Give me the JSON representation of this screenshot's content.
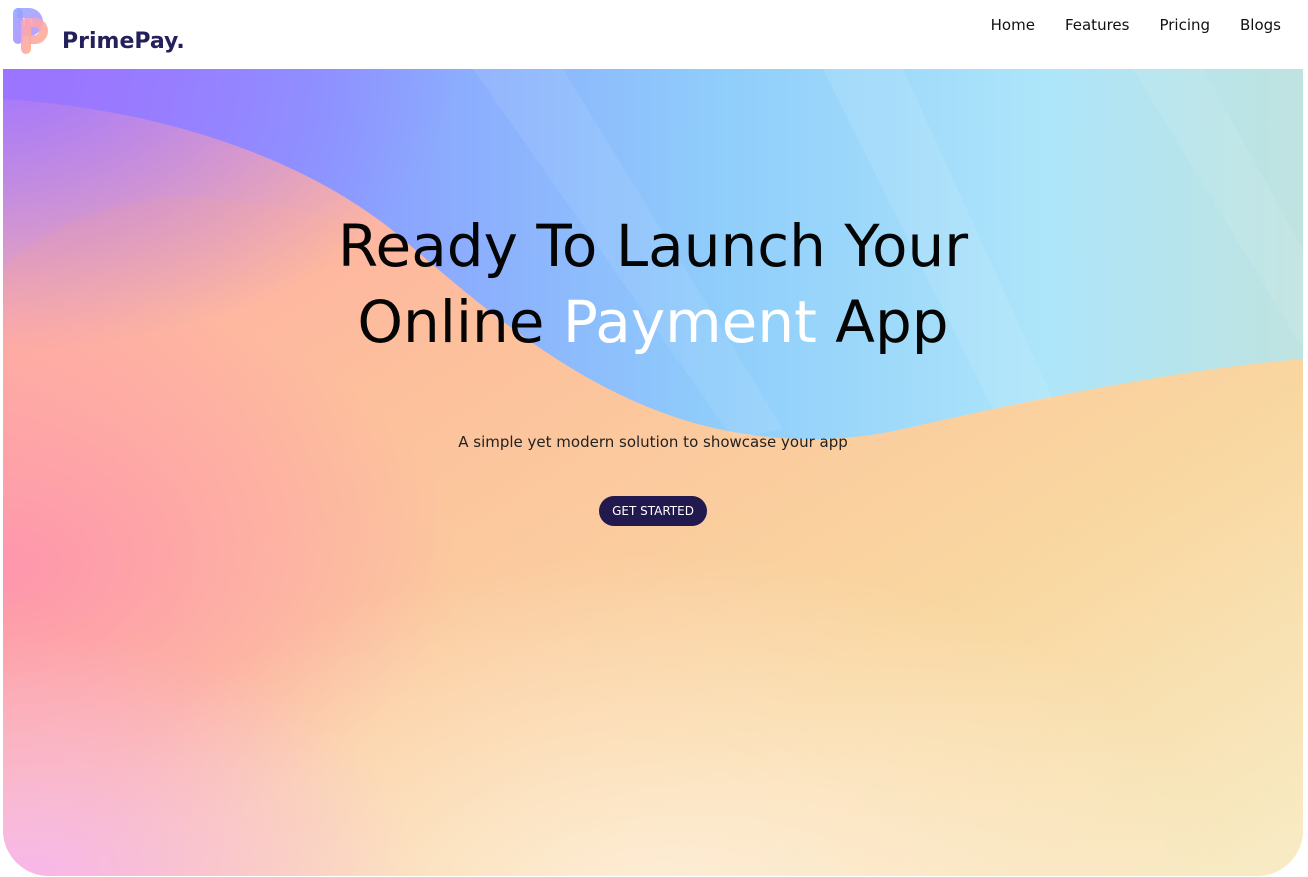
{
  "brand": {
    "name": "PrimePay.",
    "logo_icon": "primepay-p-logo-icon"
  },
  "nav": {
    "items": [
      {
        "label": "Home"
      },
      {
        "label": "Features"
      },
      {
        "label": "Pricing"
      },
      {
        "label": "Blogs"
      }
    ]
  },
  "hero": {
    "title_line1": "Ready To Launch Your",
    "title_line2_before": "Online ",
    "title_line2_accent": "Payment",
    "title_line2_after": " App",
    "subtitle": "A simple yet modern solution to showcase your app",
    "cta_label": "GET STARTED"
  },
  "colors": {
    "brand_text": "#24205a",
    "cta_background": "#221a4f",
    "accent_word": "#ffffff",
    "gradient_purple": "#9a7bff",
    "gradient_blue": "#8ecdfb",
    "gradient_peach": "#fdbf9a",
    "gradient_yellow": "#f6e0a8"
  }
}
